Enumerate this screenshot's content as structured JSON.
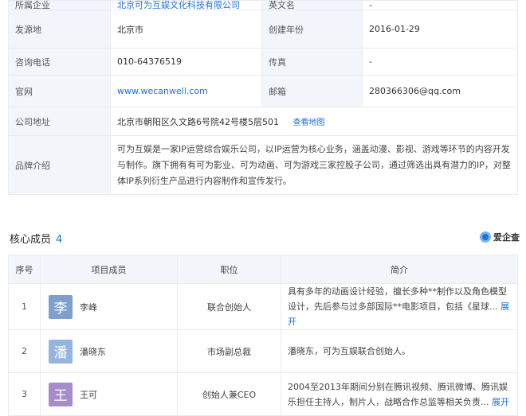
{
  "info": {
    "rows": [
      {
        "label": "所属企业",
        "value": "北京可为互娱文化科技有限公司",
        "label2": "英文名",
        "value2": "-"
      },
      {
        "label": "发源地",
        "value": "北京市",
        "label2": "创建年份",
        "value2": "2016-01-29"
      },
      {
        "label": "咨询电话",
        "value": "010-64376519",
        "label2": "传真",
        "value2": "-"
      },
      {
        "label": "官网",
        "value": "www.wecanwell.com",
        "label2": "邮箱",
        "value2": "280366306@qq.com"
      }
    ],
    "address_label": "公司地址",
    "address": "北京市朝阳区久文路6号院42号楼5层501",
    "map_link": "查看地图",
    "brand_label": "品牌介绍",
    "brand_text": "可为互娱是一家IP运营综合娱乐公司，以IP运营为核心业务，涵盖动漫、影视、游戏等环节的内容开发与制作。旗下拥有有可为影业、可为动画、可为游戏三家控股子公司，通过筛选出具有潜力的IP，对整体IP系列衍生产品进行内容制作和宣传发行。"
  },
  "members_section": {
    "title": "核心成员",
    "count": "4",
    "logo": "爱企查",
    "headers": [
      "序号",
      "项目成员",
      "职位",
      "简介"
    ],
    "rows": [
      {
        "idx": "1",
        "avatar": "李",
        "avatar_color": "#7f9fcf",
        "name": "李峰",
        "role": "联合创始人",
        "bio": "具有多年的动画设计经验，擅长多种**制作以及角色模型设计，先后参与过多部国际**电影项目，包括《星球...",
        "expand": "展开"
      },
      {
        "idx": "2",
        "avatar": "潘",
        "avatar_color": "#94b6de",
        "name": "潘晓东",
        "role": "市场副总裁",
        "bio": "潘晓东，可为互娱联合创始人。",
        "expand": ""
      },
      {
        "idx": "3",
        "avatar": "王",
        "avatar_color": "#a68cc8",
        "name": "王可",
        "role": "创始人兼CEO",
        "bio": "2004至2013年期间分别在腾讯视频、腾讯微博、腾讯娱乐担任主持人，制片人，战略合作总监等相关负责...",
        "expand": "展开"
      }
    ]
  }
}
